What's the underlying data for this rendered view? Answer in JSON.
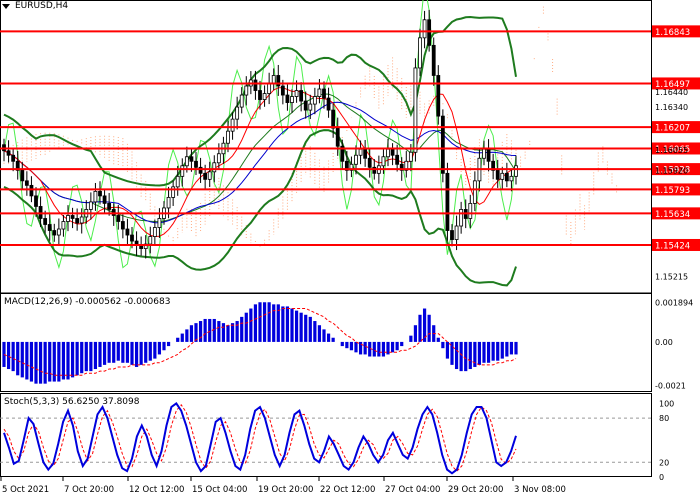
{
  "header": {
    "symbol_label": "EURUSD,H4"
  },
  "macd": {
    "label": "MACD(12,26,9) -0.000562 -0.000683"
  },
  "stoch": {
    "label": "Stoch(5,3,3) 56.6250 37.8098"
  },
  "colors": {
    "level_line": "#ff0000",
    "level_tag_bg": "#ff0000",
    "level_tag_text": "#ffffff",
    "candle": "#000000",
    "bollinger": "#1e7b1e",
    "envelope": "#4cee4c",
    "tenkan": "#ff0000",
    "kijun": "#0000cc",
    "cloud": "#ff9966",
    "macd_hist": "#0000dd",
    "macd_signal": "#ff0000",
    "stoch_main": "#0000dd",
    "stoch_signal": "#ff0000",
    "grid": "#d8d8d8",
    "axis_text": "#000000"
  },
  "chart_data": [
    {
      "type": "candlestick",
      "title": "EURUSD,H4",
      "ylim": [
        1.15105,
        1.16965
      ],
      "y_ticks": [
        "1.16843",
        "1.16497",
        "1.16440",
        "1.16340",
        "1.16207",
        "1.16065",
        "1.16055",
        "1.15928",
        "1.15920",
        "1.15793",
        "1.15634",
        "1.15424",
        "1.15215"
      ],
      "levels": [
        1.16843,
        1.16497,
        1.16207,
        1.16065,
        1.15928,
        1.15793,
        1.15634,
        1.15424
      ],
      "level_labels": [
        "1.16843",
        "1.16497",
        "1.16207",
        "1.16065",
        "1.15928",
        "1.15793",
        "1.15634",
        "1.15424"
      ],
      "axis_values": [
        {
          "value": 1.1644,
          "label": "1.16440"
        },
        {
          "value": 1.1634,
          "label": "1.16340"
        },
        {
          "value": 1.16055,
          "label": "1.16055"
        },
        {
          "value": 1.1592,
          "label": "1.15920"
        },
        {
          "value": 1.15215,
          "label": "1.15215"
        }
      ],
      "x_labels": [
        "5 Oct 2021",
        "7 Oct 20:00",
        "12 Oct 12:00",
        "15 Oct 04:00",
        "19 Oct 20:00",
        "22 Oct 12:00",
        "27 Oct 04:00",
        "29 Oct 20:00",
        "3 Nov 08:00"
      ],
      "series_close": [
        1.1605,
        1.1602,
        1.1598,
        1.1592,
        1.1585,
        1.1582,
        1.1575,
        1.1568,
        1.156,
        1.1556,
        1.1552,
        1.1549,
        1.1553,
        1.1558,
        1.1562,
        1.156,
        1.1557,
        1.1561,
        1.1566,
        1.1571,
        1.1578,
        1.1575,
        1.157,
        1.1566,
        1.1562,
        1.1558,
        1.1553,
        1.1549,
        1.1545,
        1.1542,
        1.154,
        1.1543,
        1.1548,
        1.1554,
        1.156,
        1.1567,
        1.1574,
        1.1581,
        1.1588,
        1.1595,
        1.1601,
        1.1598,
        1.1594,
        1.159,
        1.1586,
        1.1591,
        1.1597,
        1.1603,
        1.161,
        1.1618,
        1.1626,
        1.1634,
        1.1642,
        1.1648,
        1.1652,
        1.1645,
        1.1639,
        1.1643,
        1.165,
        1.1655,
        1.1648,
        1.1642,
        1.1637,
        1.1641,
        1.1645,
        1.1638,
        1.1632,
        1.1636,
        1.1641,
        1.1646,
        1.164,
        1.1632,
        1.162,
        1.1608,
        1.1598,
        1.1592,
        1.1596,
        1.1602,
        1.1606,
        1.16,
        1.1594,
        1.159,
        1.1595,
        1.1601,
        1.1606,
        1.1602,
        1.1596,
        1.1592,
        1.1598,
        1.1604,
        1.166,
        1.168,
        1.1692,
        1.1675,
        1.1655,
        1.1628,
        1.159,
        1.1552,
        1.1546,
        1.1555,
        1.1566,
        1.156,
        1.157,
        1.1585,
        1.16,
        1.1606,
        1.1598,
        1.1592,
        1.1586,
        1.159,
        1.1585,
        1.1588,
        1.1595
      ],
      "macd_ylim": [
        -0.0024,
        0.0022
      ],
      "macd_ticks": [
        "0.001894",
        "0.00",
        "-0.0021"
      ],
      "macd_hist": [
        -0.0012,
        -0.0013,
        -0.0014,
        -0.0016,
        -0.0017,
        -0.0018,
        -0.0019,
        -0.002,
        -0.002,
        -0.002,
        -0.0019,
        -0.0019,
        -0.0019,
        -0.0018,
        -0.0018,
        -0.0017,
        -0.0016,
        -0.0015,
        -0.0014,
        -0.0014,
        -0.0013,
        -0.0012,
        -0.0011,
        -0.001,
        -0.001,
        -0.0009,
        -0.001,
        -0.001,
        -0.0011,
        -0.0012,
        -0.0011,
        -0.001,
        -0.0009,
        -0.0008,
        -0.0006,
        -0.0004,
        -0.0002,
        0.0,
        0.0002,
        0.0004,
        0.0006,
        0.0008,
        0.0009,
        0.001,
        0.0011,
        0.0011,
        0.0011,
        0.001,
        0.0009,
        0.0008,
        0.0009,
        0.001,
        0.0012,
        0.0014,
        0.0016,
        0.0018,
        0.0019,
        0.0019,
        0.0019,
        0.0018,
        0.0018,
        0.0017,
        0.0017,
        0.0016,
        0.0015,
        0.0014,
        0.0013,
        0.0012,
        0.001,
        0.0008,
        0.0006,
        0.0004,
        0.0002,
        0.0,
        -0.0002,
        -0.0003,
        -0.0004,
        -0.0005,
        -0.0006,
        -0.0006,
        -0.0007,
        -0.0007,
        -0.0007,
        -0.0007,
        -0.0006,
        -0.0005,
        -0.0004,
        -0.0002,
        0.0,
        0.0003,
        0.0008,
        0.0013,
        0.0016,
        0.0013,
        0.0008,
        0.0002,
        -0.0003,
        -0.0008,
        -0.0011,
        -0.0013,
        -0.0014,
        -0.0014,
        -0.0013,
        -0.0012,
        -0.0011,
        -0.001,
        -0.001,
        -0.0009,
        -0.0009,
        -0.0008,
        -0.0007,
        -0.0006,
        -0.0006
      ],
      "macd_signal": [
        -0.0006,
        -0.0007,
        -0.0008,
        -0.0009,
        -0.001,
        -0.0011,
        -0.0012,
        -0.0013,
        -0.0014,
        -0.0015,
        -0.0015,
        -0.0016,
        -0.0016,
        -0.0016,
        -0.0016,
        -0.0016,
        -0.0016,
        -0.0016,
        -0.0015,
        -0.0015,
        -0.0015,
        -0.0014,
        -0.0014,
        -0.0013,
        -0.0013,
        -0.0012,
        -0.0012,
        -0.0012,
        -0.0011,
        -0.0011,
        -0.0011,
        -0.0011,
        -0.0011,
        -0.001,
        -0.001,
        -0.0009,
        -0.0008,
        -0.0007,
        -0.0006,
        -0.0004,
        -0.0003,
        -0.0001,
        0.0001,
        0.0002,
        0.0004,
        0.0005,
        0.0006,
        0.0007,
        0.0007,
        0.0008,
        0.0008,
        0.0008,
        0.0009,
        0.0009,
        0.001,
        0.0011,
        0.0012,
        0.0013,
        0.0014,
        0.0015,
        0.0015,
        0.0016,
        0.0016,
        0.0016,
        0.0016,
        0.0016,
        0.0016,
        0.0015,
        0.0014,
        0.0013,
        0.0012,
        0.001,
        0.0009,
        0.0007,
        0.0005,
        0.0003,
        0.0002,
        0.0,
        -0.0001,
        -0.0002,
        -0.0003,
        -0.0004,
        -0.0005,
        -0.0005,
        -0.0005,
        -0.0005,
        -0.0005,
        -0.0004,
        -0.0004,
        -0.0003,
        -0.0002,
        0.0,
        0.0002,
        0.0004,
        0.0004,
        0.0004,
        0.0002,
        0.0,
        -0.0002,
        -0.0004,
        -0.0006,
        -0.0008,
        -0.0009,
        -0.001,
        -0.0011,
        -0.0011,
        -0.0011,
        -0.0011,
        -0.001,
        -0.001,
        -0.0009,
        -0.0009,
        -0.0008
      ],
      "stoch_ylim": [
        0,
        110
      ],
      "stoch_ticks": [
        100,
        80,
        20,
        0
      ],
      "stoch_main": [
        60,
        40,
        18,
        22,
        50,
        80,
        72,
        45,
        20,
        10,
        18,
        45,
        75,
        90,
        70,
        35,
        15,
        25,
        55,
        85,
        95,
        80,
        55,
        30,
        12,
        8,
        25,
        55,
        70,
        55,
        30,
        15,
        35,
        70,
        95,
        100,
        90,
        70,
        45,
        20,
        8,
        15,
        45,
        75,
        80,
        60,
        35,
        15,
        10,
        30,
        65,
        90,
        95,
        80,
        55,
        30,
        15,
        30,
        60,
        85,
        90,
        70,
        45,
        25,
        20,
        35,
        55,
        45,
        30,
        15,
        10,
        20,
        40,
        55,
        45,
        30,
        20,
        30,
        50,
        60,
        45,
        30,
        25,
        40,
        65,
        85,
        95,
        85,
        60,
        30,
        10,
        5,
        10,
        30,
        60,
        85,
        95,
        95,
        80,
        50,
        20,
        15,
        20,
        35,
        56
      ],
      "stoch_signal": [
        65,
        55,
        35,
        25,
        35,
        60,
        72,
        62,
        40,
        22,
        15,
        25,
        50,
        75,
        80,
        62,
        38,
        22,
        32,
        58,
        82,
        90,
        75,
        55,
        32,
        15,
        14,
        30,
        55,
        65,
        50,
        32,
        22,
        40,
        70,
        90,
        98,
        88,
        68,
        44,
        22,
        12,
        22,
        48,
        70,
        75,
        60,
        38,
        20,
        18,
        36,
        65,
        86,
        92,
        78,
        55,
        32,
        22,
        38,
        65,
        84,
        85,
        68,
        45,
        30,
        26,
        38,
        50,
        45,
        30,
        18,
        14,
        24,
        40,
        50,
        44,
        30,
        25,
        32,
        50,
        55,
        45,
        32,
        30,
        42,
        65,
        85,
        92,
        82,
        58,
        32,
        15,
        8,
        15,
        35,
        62,
        85,
        95,
        90,
        74,
        48,
        24,
        18,
        24,
        38
      ]
    }
  ]
}
